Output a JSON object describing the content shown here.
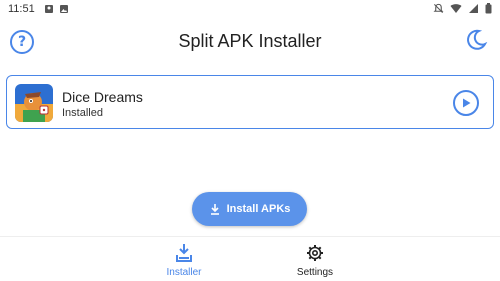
{
  "status_bar": {
    "time": "11:51",
    "left_icons": [
      "photo-icon",
      "image-icon"
    ],
    "right_icons": [
      "notifications-off-icon",
      "wifi-icon",
      "signal-icon",
      "battery-icon"
    ]
  },
  "header": {
    "title": "Split APK Installer",
    "help_icon": "help-icon",
    "theme_icon": "moon-icon"
  },
  "app_card": {
    "name": "Dice Dreams",
    "status": "Installed",
    "launch_icon": "play-icon"
  },
  "install_button": {
    "label": "Install APKs",
    "icon": "download-icon"
  },
  "bottom_nav": {
    "items": [
      {
        "label": "Installer",
        "icon": "installer-icon",
        "active": true
      },
      {
        "label": "Settings",
        "icon": "gear-icon",
        "active": false
      }
    ]
  },
  "colors": {
    "accent": "#4a86e8",
    "button": "#5b93ea"
  }
}
